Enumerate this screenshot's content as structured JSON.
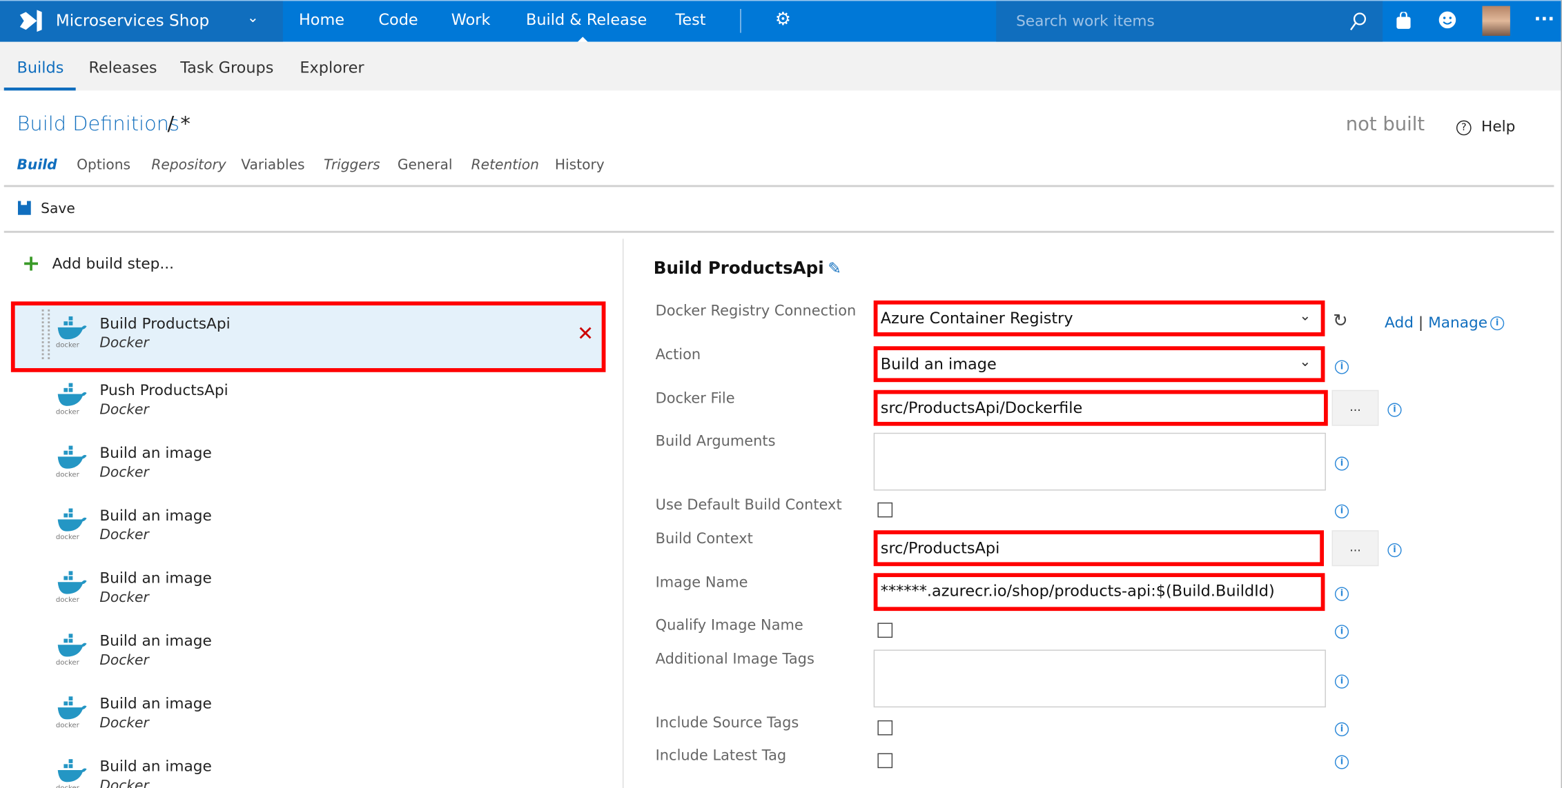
{
  "header": {
    "project": "Microservices Shop",
    "nav": [
      "Home",
      "Code",
      "Work",
      "Build & Release",
      "Test"
    ],
    "active_nav": "Build & Release",
    "search_placeholder": "Search work items"
  },
  "subnav": {
    "items": [
      "Builds",
      "Releases",
      "Task Groups",
      "Explorer"
    ],
    "active": "Builds"
  },
  "page": {
    "breadcrumb_link": "Build Definitions",
    "breadcrumb_rest": "/ *",
    "status": "not built",
    "help": "Help",
    "tabs": [
      "Build",
      "Options",
      "Repository",
      "Variables",
      "Triggers",
      "General",
      "Retention",
      "History"
    ],
    "save": "Save"
  },
  "steps": {
    "add_label": "Add build step...",
    "items": [
      {
        "title": "Build ProductsApi",
        "type": "Docker"
      },
      {
        "title": "Push ProductsApi",
        "type": "Docker"
      },
      {
        "title": "Build an image",
        "type": "Docker"
      },
      {
        "title": "Build an image",
        "type": "Docker"
      },
      {
        "title": "Build an image",
        "type": "Docker"
      },
      {
        "title": "Build an image",
        "type": "Docker"
      },
      {
        "title": "Build an image",
        "type": "Docker"
      },
      {
        "title": "Build an image",
        "type": "Docker"
      }
    ]
  },
  "detail": {
    "title": "Build ProductsApi",
    "labels": {
      "registry": "Docker Registry Connection",
      "action": "Action",
      "docker_file": "Docker File",
      "build_args": "Build Arguments",
      "use_default_ctx": "Use Default Build Context",
      "build_ctx": "Build Context",
      "image_name": "Image Name",
      "qualify": "Qualify Image Name",
      "additional_tags": "Additional Image Tags",
      "source_tags": "Include Source Tags",
      "latest_tag": "Include Latest Tag"
    },
    "values": {
      "registry": "Azure Container Registry",
      "action": "Build an image",
      "docker_file": "src/ProductsApi/Dockerfile",
      "build_ctx": "src/ProductsApi",
      "image_name": "******.azurecr.io/shop/products-api:$(Build.BuildId)"
    },
    "add": "Add",
    "sep": "|",
    "manage": "Manage",
    "browse": "..."
  },
  "colors": {
    "brand": "#0078d7",
    "highlight": "#ff0000",
    "selected_bg": "#e4f1fa"
  }
}
